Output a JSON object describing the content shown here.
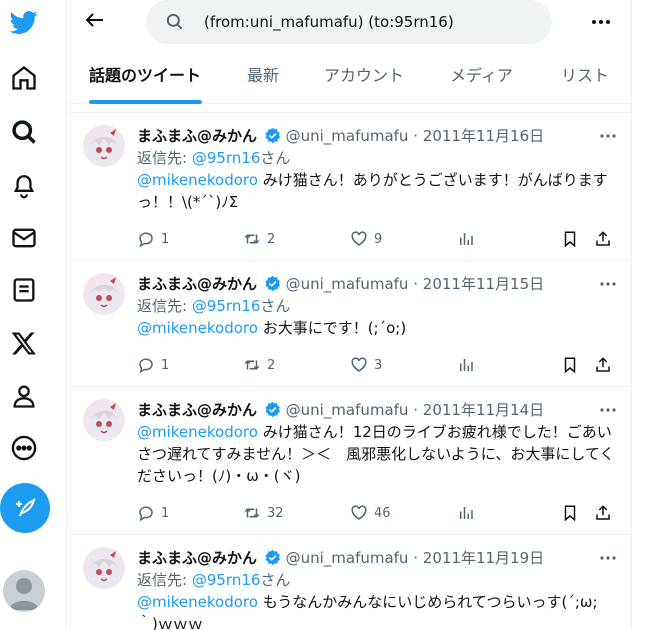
{
  "search": {
    "query": "(from:uni_mafumafu) (to:95rn16)"
  },
  "tabs": [
    "話題のツイート",
    "最新",
    "アカウント",
    "メディア",
    "リスト"
  ],
  "tweets": [
    {
      "name": "まふまふ@みかん",
      "handle": "@uni_mafumafu",
      "sep": "·",
      "date": "2011年11月16日",
      "reply_prefix": "返信先: ",
      "reply_to": "@95rn16",
      "reply_suffix": "さん",
      "mention": "@mikenekodoro",
      "text": " みけ猫さん！ありがとうございます！がんばりますっ！！\\(*´`)ﾉΣ",
      "replies": "1",
      "retweets": "2",
      "likes": "9"
    },
    {
      "name": "まふまふ@みかん",
      "handle": "@uni_mafumafu",
      "sep": "·",
      "date": "2011年11月15日",
      "reply_prefix": "返信先: ",
      "reply_to": "@95rn16",
      "reply_suffix": "さん",
      "mention": "@mikenekodoro",
      "text": " お大事にです！(;´o;)",
      "replies": "1",
      "retweets": "2",
      "likes": "3"
    },
    {
      "name": "まふまふ@みかん",
      "handle": "@uni_mafumafu",
      "sep": "·",
      "date": "2011年11月14日",
      "reply_prefix": "",
      "reply_to": "",
      "reply_suffix": "",
      "mention": "@mikenekodoro",
      "text": " みけ猫さん！12日のライブお疲れ様でした！ごあいさつ遅れてすみません！＞＜　風邪悪化しないように、お大事にしてくださいっ！(ﾉ)・ω・(ヾ)",
      "replies": "1",
      "retweets": "32",
      "likes": "46"
    },
    {
      "name": "まふまふ@みかん",
      "handle": "@uni_mafumafu",
      "sep": "·",
      "date": "2011年11月19日",
      "reply_prefix": "返信先: ",
      "reply_to": "@95rn16",
      "reply_suffix": "さん",
      "mention": "@mikenekodoro",
      "text": " もうなんかみんなにいじめられてつらいっす(´;ω;｀)ｗｗｗ",
      "replies": "",
      "retweets": "",
      "likes": ""
    }
  ],
  "colors": {
    "accent": "#1d9bf0",
    "secondary": "#536471",
    "text": "#0f1419"
  },
  "icons": [
    "twitter-logo-icon",
    "home-icon",
    "search-icon",
    "notifications-icon",
    "messages-icon",
    "lists-icon",
    "x-logo-icon",
    "profile-icon",
    "more-icon",
    "post-icon",
    "back-arrow-icon",
    "more-horizontal-icon",
    "verified-icon",
    "reply-icon",
    "retweet-icon",
    "like-icon",
    "views-icon",
    "bookmark-icon",
    "share-icon"
  ]
}
